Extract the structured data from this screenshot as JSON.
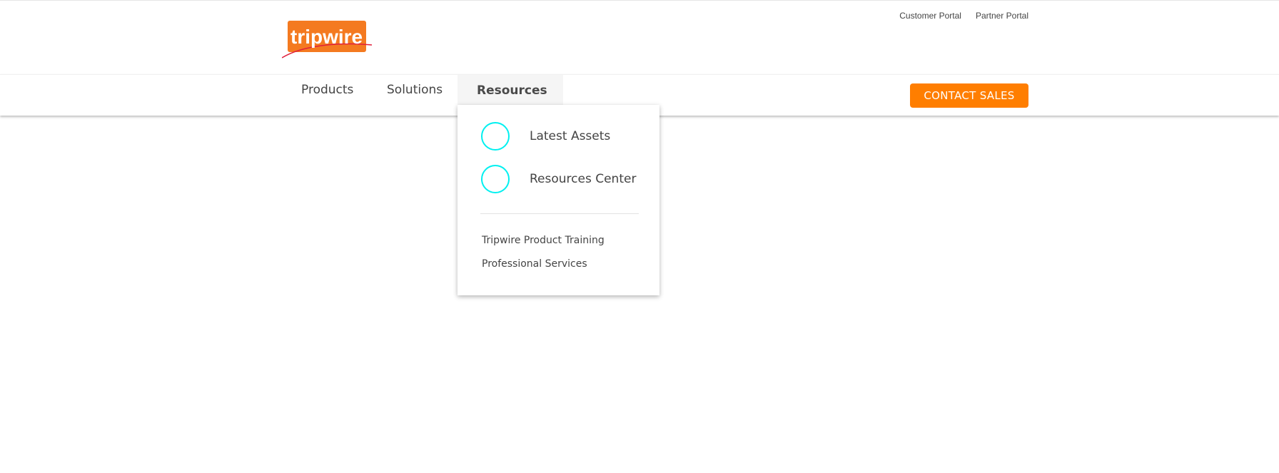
{
  "header": {
    "logo_text": "tripwire",
    "utility_links": [
      "Customer Portal",
      "Partner Portal"
    ]
  },
  "nav": {
    "items": [
      {
        "label": "Products",
        "active": false
      },
      {
        "label": "Solutions",
        "active": false
      },
      {
        "label": "Resources",
        "active": true
      }
    ],
    "cta_label": "CONTACT SALES"
  },
  "resources_menu": {
    "featured": [
      {
        "label": "Latest Assets",
        "icon": "ring-icon"
      },
      {
        "label": "Resources Center",
        "icon": "ring-icon"
      }
    ],
    "links": [
      "Tripwire Product Training",
      "Professional Services"
    ]
  },
  "colors": {
    "brand_orange": "#ff7e00",
    "icon_ring": "#00f0f0",
    "text": "#444444"
  }
}
